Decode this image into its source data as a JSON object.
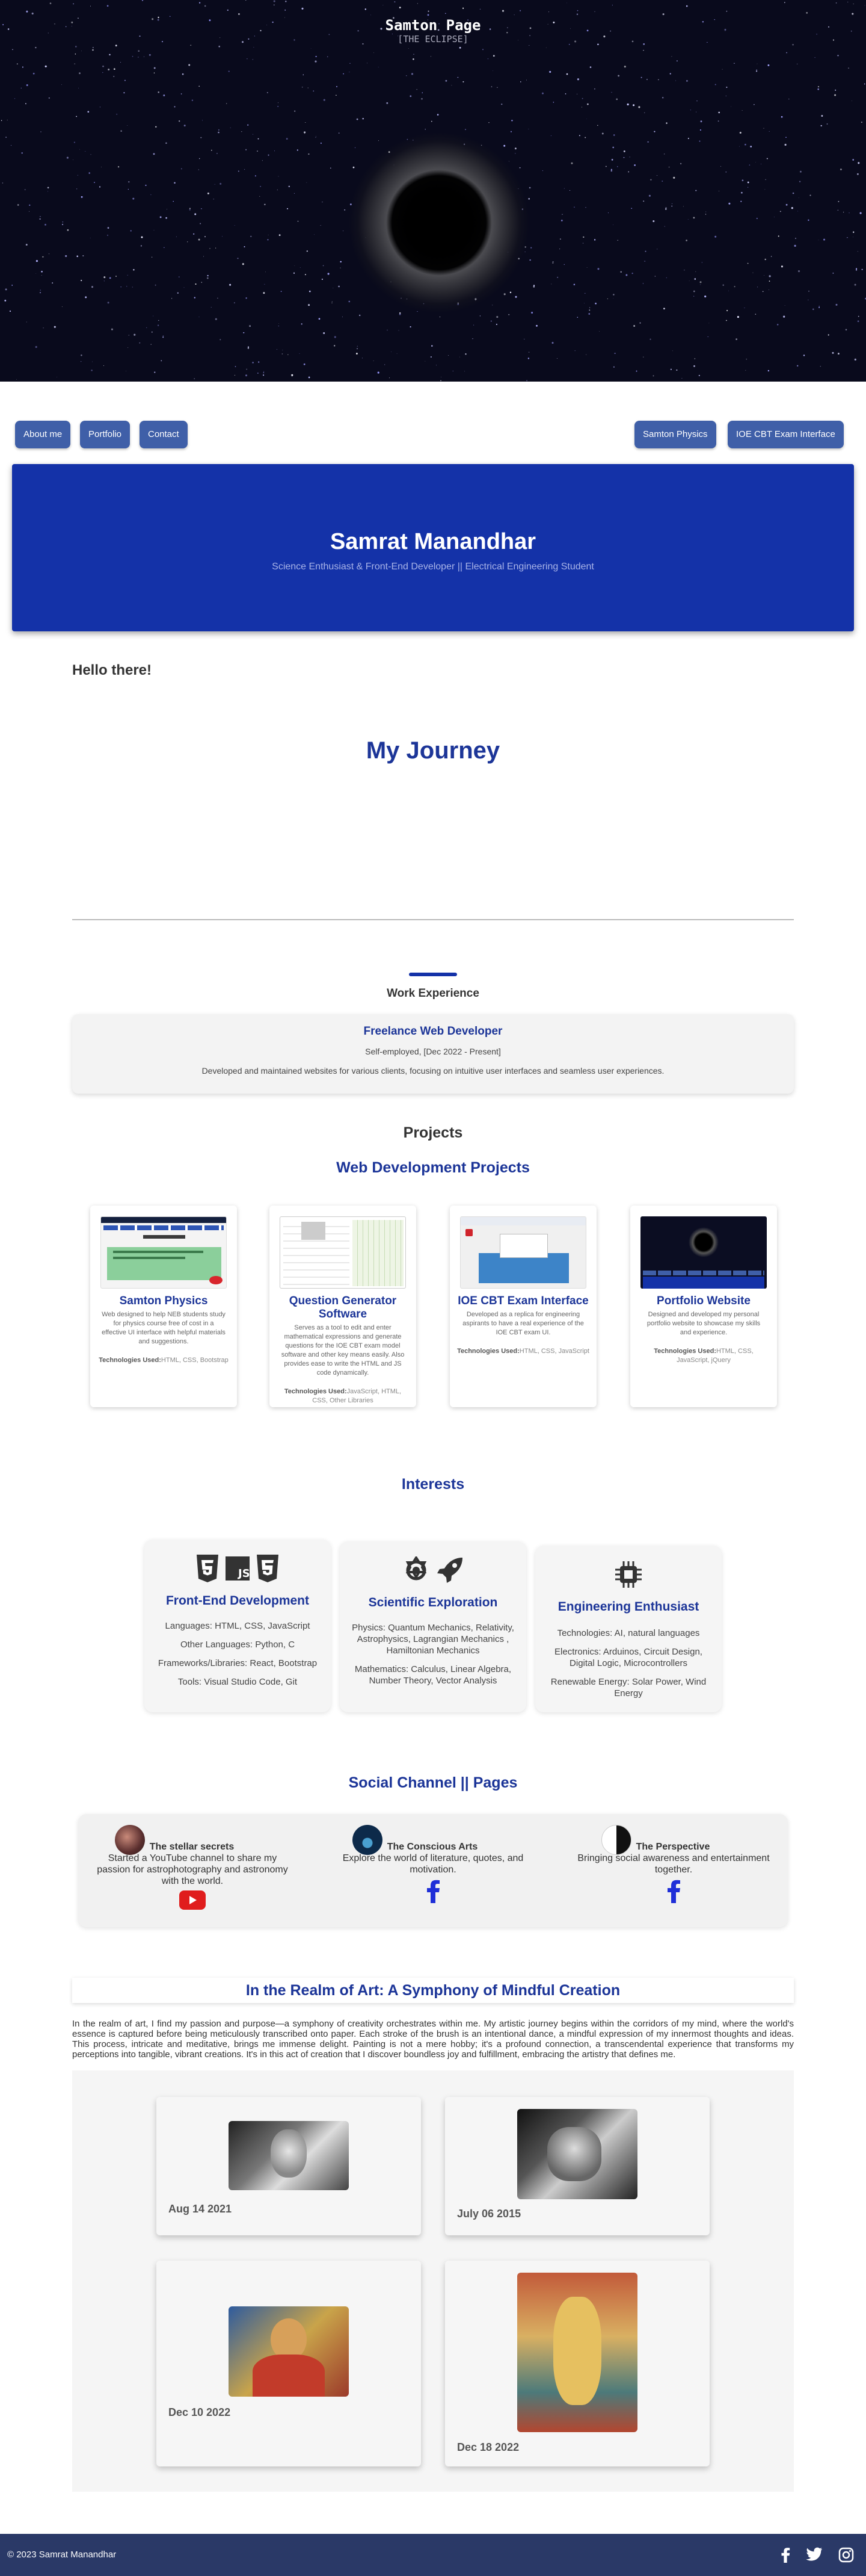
{
  "hero": {
    "title": "Samton Page",
    "subtitle": "[THE ECLIPSE]"
  },
  "nav": {
    "left": [
      "About me",
      "Portfolio",
      "Contact"
    ],
    "right": [
      "Samton Physics",
      "IOE CBT Exam Interface"
    ]
  },
  "profile": {
    "name": "Samrat Manandhar",
    "tagline": "Science Enthusiast & Front-End Developer || Electrical Engineering Student"
  },
  "greeting": "Hello there!",
  "journey_title": "My Journey",
  "work": {
    "section_title": "Work Experience",
    "role": "Freelance Web Developer",
    "period": "Self-employed, [Dec 2022 - Present]",
    "description": "Developed and maintained websites for various clients, focusing on intuitive user interfaces and seamless user experiences."
  },
  "projects": {
    "section_title": "Projects",
    "subtitle": "Web Development Projects",
    "tech_label": "Technologies Used:",
    "items": [
      {
        "name": "Samton Physics",
        "description": "Web designed to help NEB students study for physics course free of cost in a effective UI interface with helpful materials and suggestions.",
        "tech": "HTML, CSS, Bootstrap"
      },
      {
        "name": "Question Generator Software",
        "description": "Serves as a tool to edit and enter mathematical expressions and generate questions for the IOE CBT exam model software and other key means easily. Also provides ease to write the HTML and JS code dynamically.",
        "tech": "JavaScript, HTML, CSS, Other Libraries"
      },
      {
        "name": "IOE CBT Exam Interface",
        "description": "Developed as a replica for engineering aspirants to have a real experience of the IOE CBT exam UI.",
        "tech": "HTML, CSS, JavaScript"
      },
      {
        "name": "Portfolio Website",
        "description": "Designed and developed my personal portfolio website to showcase my skills and experience.",
        "tech": "HTML, CSS, JavaScript, jQuery"
      }
    ]
  },
  "interests": {
    "section_title": "Interests",
    "items": [
      {
        "name": "Front-End Development",
        "icons": [
          "html5-icon",
          "js-icon",
          "css3-icon"
        ],
        "lines": [
          "Languages: HTML, CSS, JavaScript",
          "Other Languages: Python, C",
          "Frameworks/Libraries: React, Bootstrap",
          "Tools: Visual Studio Code, Git"
        ]
      },
      {
        "name": "Scientific Exploration",
        "icons": [
          "atom-icon",
          "rocket-icon"
        ],
        "lines": [
          "Physics: Quantum Mechanics, Relativity, Astrophysics, Lagrangian Mechanics , Hamiltonian Mechanics",
          "Mathematics: Calculus, Linear Algebra, Number Theory, Vector Analysis"
        ]
      },
      {
        "name": "Engineering Enthusiast",
        "icons": [
          "microchip-icon"
        ],
        "lines": [
          "Technologies: AI, natural languages",
          "Electronics: Arduinos, Circuit Design, Digital Logic, Microcontrollers",
          "Renewable Energy: Solar Power, Wind Energy"
        ]
      }
    ]
  },
  "social": {
    "section_title": "Social Channel || Pages",
    "items": [
      {
        "name": "The stellar secrets",
        "description": "Started a YouTube channel to share my passion for astrophotography and astronomy with the world.",
        "platform": "youtube-icon"
      },
      {
        "name": "The Conscious Arts",
        "description": "Explore the world of literature, quotes, and motivation.",
        "platform": "facebook-icon"
      },
      {
        "name": "The Perspective",
        "description": "Bringing social awareness and entertainment together.",
        "platform": "facebook-icon"
      }
    ]
  },
  "art": {
    "title": "In the Realm of Art: A Symphony of Mindful Creation",
    "text": "In the realm of art, I find my passion and purpose—a symphony of creativity orchestrates within me. My artistic journey begins within the corridors of my mind, where the world's essence is captured before being meticulously transcribed onto paper. Each stroke of the brush is an intentional dance, a mindful expression of my innermost thoughts and ideas. This process, intricate and meditative, brings me immense delight. Painting is not a mere hobby; it's a profound connection, a transcendental experience that transforms my perceptions into tangible, vibrant creations. It's in this act of creation that I discover boundless joy and fulfillment, embracing the artistry that defines me.",
    "works": [
      {
        "date": "Aug 14 2021"
      },
      {
        "date": "July 06 2015"
      },
      {
        "date": "Dec 10 2022"
      },
      {
        "date": "Dec 18 2022"
      }
    ]
  },
  "footer": {
    "copyright": "© 2023 Samrat Manandhar",
    "icons": [
      "facebook-icon",
      "twitter-icon",
      "instagram-icon"
    ]
  },
  "colors": {
    "accent": "#1c3598",
    "banner": "#1432a8",
    "nav_button": "#3f5fa8",
    "footer": "#2a3967"
  }
}
